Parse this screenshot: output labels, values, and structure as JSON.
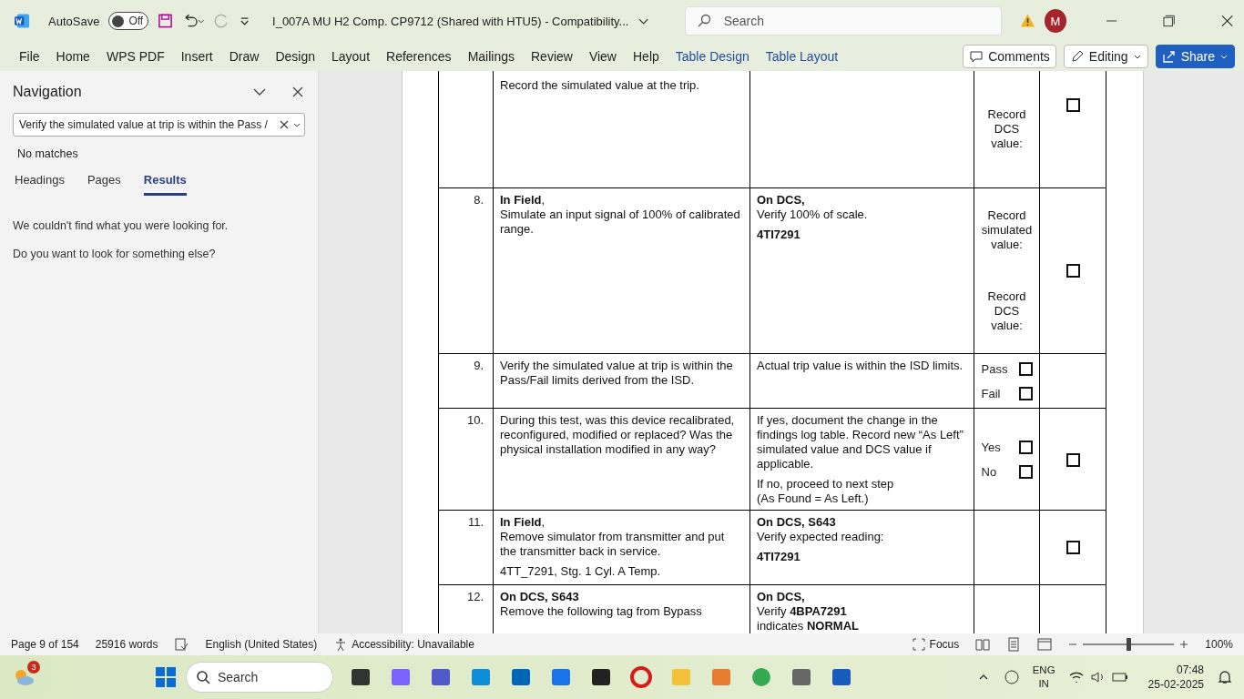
{
  "title_bar": {
    "autosave_label": "AutoSave",
    "autosave_on": false,
    "autosave_state": "Off",
    "document_title": "I_007A MU H2 Comp. CP9712 (Shared with HTU5)  -  Compatibility...",
    "search_placeholder": "Search",
    "avatar": "M"
  },
  "ribbon_tabs": [
    {
      "label": "File",
      "kind": "standard"
    },
    {
      "label": "Home",
      "kind": "standard"
    },
    {
      "label": "WPS PDF",
      "kind": "standard"
    },
    {
      "label": "Insert",
      "kind": "standard"
    },
    {
      "label": "Draw",
      "kind": "standard"
    },
    {
      "label": "Design",
      "kind": "standard"
    },
    {
      "label": "Layout",
      "kind": "standard"
    },
    {
      "label": "References",
      "kind": "standard"
    },
    {
      "label": "Mailings",
      "kind": "standard"
    },
    {
      "label": "Review",
      "kind": "standard"
    },
    {
      "label": "View",
      "kind": "standard"
    },
    {
      "label": "Help",
      "kind": "standard"
    },
    {
      "label": "Table Design",
      "kind": "contextual"
    },
    {
      "label": "Table Layout",
      "kind": "contextual"
    }
  ],
  "ribbon_buttons": {
    "comments": "Comments",
    "editing": "Editing",
    "share": "Share"
  },
  "navigation": {
    "title": "Navigation",
    "search_value": "Verify the simulated value at trip is within the Pass /",
    "result_status": "No matches",
    "tabs": [
      {
        "label": "Headings",
        "selected": false
      },
      {
        "label": "Pages",
        "selected": false
      },
      {
        "label": "Results",
        "selected": true
      }
    ],
    "messages": [
      "We couldn't find what you were looking for.",
      "Do you want to look for something else?"
    ]
  },
  "document": {
    "rows": [
      {
        "number": "",
        "step": [
          "Record the simulated value at the trip."
        ],
        "expected": [],
        "record": {
          "kind": "labels",
          "labels": [
            "Record\nDCS\nvalue:"
          ]
        },
        "signoff": {
          "checked": false
        }
      },
      {
        "number": "8.",
        "step": [
          "**In Field**,\nSimulate an input signal of 100% of calibrated range."
        ],
        "expected": [
          "**On DCS,**\nVerify 100% of scale.",
          "**4TI7291**"
        ],
        "record": {
          "kind": "labels",
          "labels": [
            "Record\nsimulated\nvalue:",
            "Record\nDCS\nvalue:"
          ]
        },
        "signoff": {
          "checked": false
        }
      },
      {
        "number": "9.",
        "step": [
          "Verify the simulated value at trip is within the Pass/Fail limits derived from the ISD."
        ],
        "expected": [
          "Actual trip value is within the ISD limits."
        ],
        "record": {
          "kind": "choices",
          "choices": [
            {
              "label": "Pass",
              "checked": false
            },
            {
              "label": "Fail",
              "checked": false
            }
          ]
        }
      },
      {
        "number": "10.",
        "step": [
          "During this test, was this device recalibrated, reconfigured, modified or replaced? Was the physical installation modified in any way?"
        ],
        "expected": [
          "If yes, document the change in the findings log table. Record new “As Left” simulated value and DCS value if applicable.",
          "If no, proceed to next step\n(As Found = As Left.)"
        ],
        "record": {
          "kind": "choices",
          "choices": [
            {
              "label": "Yes",
              "checked": false
            },
            {
              "label": "No",
              "checked": false
            }
          ]
        },
        "signoff": {
          "checked": false
        }
      },
      {
        "number": "11.",
        "step": [
          "**In Field**,\nRemove simulator from transmitter and put the transmitter back in service.",
          "4TT_7291, Stg. 1 Cyl. A Temp."
        ],
        "expected": [
          "**On DCS, S643**\nVerify expected reading:",
          "**4TI7291**"
        ],
        "record": {
          "kind": "empty"
        },
        "signoff": {
          "checked": false
        }
      },
      {
        "number": "12.",
        "step": [
          "**On DCS, S643**\nRemove the following tag from Bypass"
        ],
        "expected": [
          "**On DCS,**\nVerify **4BPA7291**\n indicates **NORMAL**"
        ],
        "record": {
          "kind": "empty"
        }
      }
    ]
  },
  "status_bar": {
    "page": "Page 9 of 154",
    "words": "25916 words",
    "language": "English (United States)",
    "accessibility": "Accessibility: Unavailable",
    "focus": "Focus",
    "zoom": "100%",
    "zoom_level": {
      "level": 0.5
    }
  },
  "taskbar": {
    "weather_badge": "3",
    "search_placeholder": "Search",
    "input_language": "ENG",
    "input_region": "IN",
    "time": "07:48",
    "date": "25-02-2025"
  }
}
